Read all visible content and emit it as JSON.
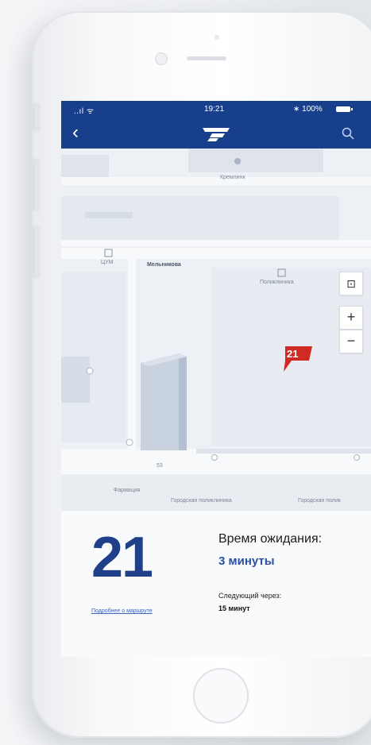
{
  "status_bar": {
    "signal": "..ıl ᯤ",
    "time": "19:21",
    "battery": "∗ 100%"
  },
  "nav": {
    "back_label": "‹"
  },
  "map": {
    "labels": {
      "top_building": "Кремлинк",
      "stop_left": "ЦУМ",
      "street": "Мельникова",
      "stop_right": "Поликлиника",
      "building_num": "53",
      "pharmacy": "Фармация",
      "polyclinic_1": "Городская поликлиника",
      "polyclinic_2": "Городская полик"
    },
    "controls": {
      "locate": "⊡",
      "zoom_in": "+",
      "zoom_out": "−"
    },
    "pin_number": "21"
  },
  "route_panel": {
    "route_number": "21",
    "route_link": "Подробнее о маршруте",
    "wait_title": "Время ожидания:",
    "wait_value": "3 минуты",
    "next_label": "Следующий через:",
    "next_value": "15 минут"
  },
  "colors": {
    "brand_blue": "#173f8c",
    "accent_red": "#d12a24",
    "route_blue": "#1f3f88"
  }
}
